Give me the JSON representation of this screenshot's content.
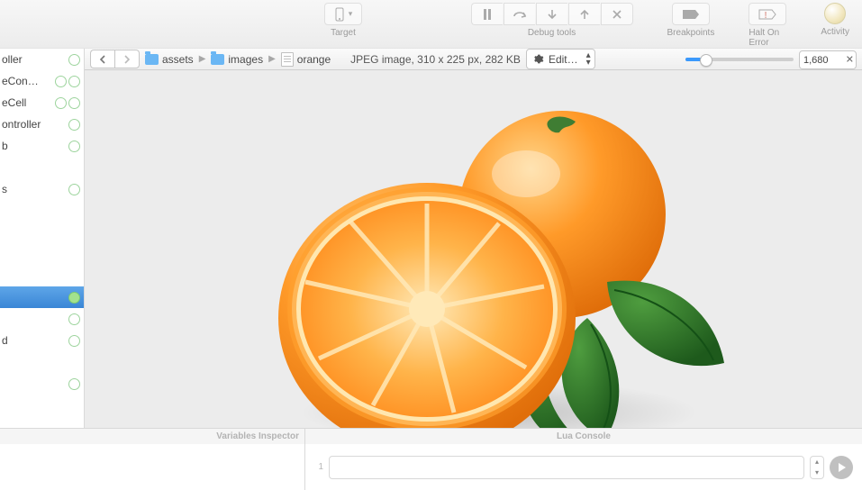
{
  "toolbar": {
    "target_label": "Target",
    "debug_label": "Debug tools",
    "breakpoints_label": "Breakpoints",
    "halt_label": "Halt On Error",
    "activity_label": "Activity"
  },
  "sidebar": {
    "variables_inspector_label": "Variables Inspector",
    "items": [
      {
        "label": "oller",
        "dots": 1
      },
      {
        "label": "eCon…",
        "dots": 2
      },
      {
        "label": "eCell",
        "dots": 2
      },
      {
        "label": "ontroller",
        "dots": 1
      },
      {
        "label": "b",
        "dots": 1
      },
      {
        "label": "",
        "dots": 0
      },
      {
        "label": "s",
        "dots": 1
      },
      {
        "label": "",
        "dots": 0
      },
      {
        "label": "",
        "dots": 0
      },
      {
        "label": "",
        "dots": 0
      },
      {
        "label": "",
        "dots": 0
      },
      {
        "label": "",
        "dots": 1,
        "selected": true
      },
      {
        "label": "",
        "dots": 1
      },
      {
        "label": "d",
        "dots": 1
      },
      {
        "label": "",
        "dots": 0
      },
      {
        "label": "",
        "dots": 1
      }
    ]
  },
  "pathbar": {
    "crumbs": [
      {
        "kind": "folder",
        "label": "assets"
      },
      {
        "kind": "folder",
        "label": "images"
      },
      {
        "kind": "file",
        "label": "orange"
      }
    ],
    "file_meta": "JPEG image,  310 x 225 px, 282 KB",
    "edit_label": "Edit…",
    "zoom_value": "1,680"
  },
  "console": {
    "lua_console_label": "Lua Console",
    "line_no": "1"
  }
}
